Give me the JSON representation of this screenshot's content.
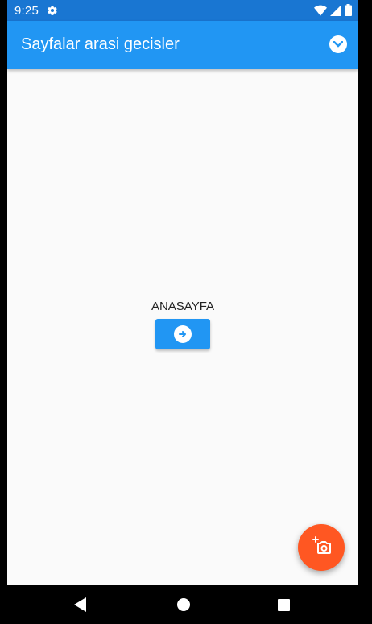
{
  "status_bar": {
    "time": "9:25",
    "icons": [
      "gear-icon",
      "wifi-icon",
      "signal-icon",
      "battery-icon"
    ]
  },
  "app_bar": {
    "title": "Sayfalar arasi gecisler",
    "dropdown_icon": "chevron-down-icon"
  },
  "main": {
    "label": "ANASAYFA",
    "button_icon": "arrow-right-icon"
  },
  "fab": {
    "icon": "add-photo-icon"
  },
  "navigation_bar": {
    "items": [
      "back-icon",
      "home-icon",
      "recents-icon"
    ]
  },
  "colors": {
    "status_bar": "#1976d2",
    "app_bar": "#2196f3",
    "background": "#fafafa",
    "button": "#2196f3",
    "fab": "#ff5722",
    "nav_bar": "#000000"
  }
}
